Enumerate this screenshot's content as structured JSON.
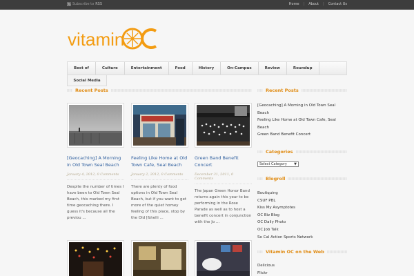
{
  "topbar": {
    "subscribe_label": "Subscribe to",
    "rss_label": "RSS",
    "links": [
      "Home",
      "About",
      "Contact Us"
    ]
  },
  "logo": {
    "text": "vitamin",
    "accent_text": "OC",
    "accent_color": "#f39c12"
  },
  "nav": {
    "items": [
      "Best of",
      "Culture",
      "Entertainment",
      "Food",
      "History",
      "On-Campus",
      "Review",
      "Roundup"
    ],
    "social": "Social Media"
  },
  "main": {
    "heading": "Recent Posts",
    "posts": [
      {
        "title": "[Geocaching] A Morning in Old Town Seal Beach",
        "meta": "January 4, 2012, 0 Comments",
        "excerpt": "Despite the number of times I have been to Old Town Seal Beach, this marked my first time geocaching there. I guess it's because all the previou ..."
      },
      {
        "title": "Feeling Like Home at Old Town Cafe, Seal Beach",
        "meta": "January 2, 2012, 0 Comments",
        "excerpt": "There are plenty of food options in Old Town Seal Beach, but if you want to get more of the quiet homey feeling of this place, stop by the Old [&helli ..."
      },
      {
        "title": "Green Band Benefit Concert",
        "meta": "December 31, 2011, 0 Comments",
        "excerpt": "The Japan Green Honor Band returns again this year to be performing in the Rose Parade as well as to host a benefit concert in conjunction with the Jo ..."
      }
    ]
  },
  "sidebar": {
    "recent_heading": "Recent Posts",
    "recent": [
      "[Geocaching] A Morning in Old Town Seal Beach",
      "Feeling Like Home at Old Town Cafe, Seal Beach",
      "Green Band Benefit Concert"
    ],
    "categories_heading": "Categories",
    "categories_select": "Select Category",
    "blogroll_heading": "Blogroll",
    "blogroll": [
      "Boutiquing",
      "CSUF PBL",
      "Kiss My Asymptotes",
      "OC Biz Blog",
      "OC Daily Photo",
      "OC Job Talk",
      "So Cal Action Sports Network"
    ],
    "web_heading": "Vitamin OC on the Web",
    "web": [
      "Delicious",
      "Flickr"
    ]
  }
}
